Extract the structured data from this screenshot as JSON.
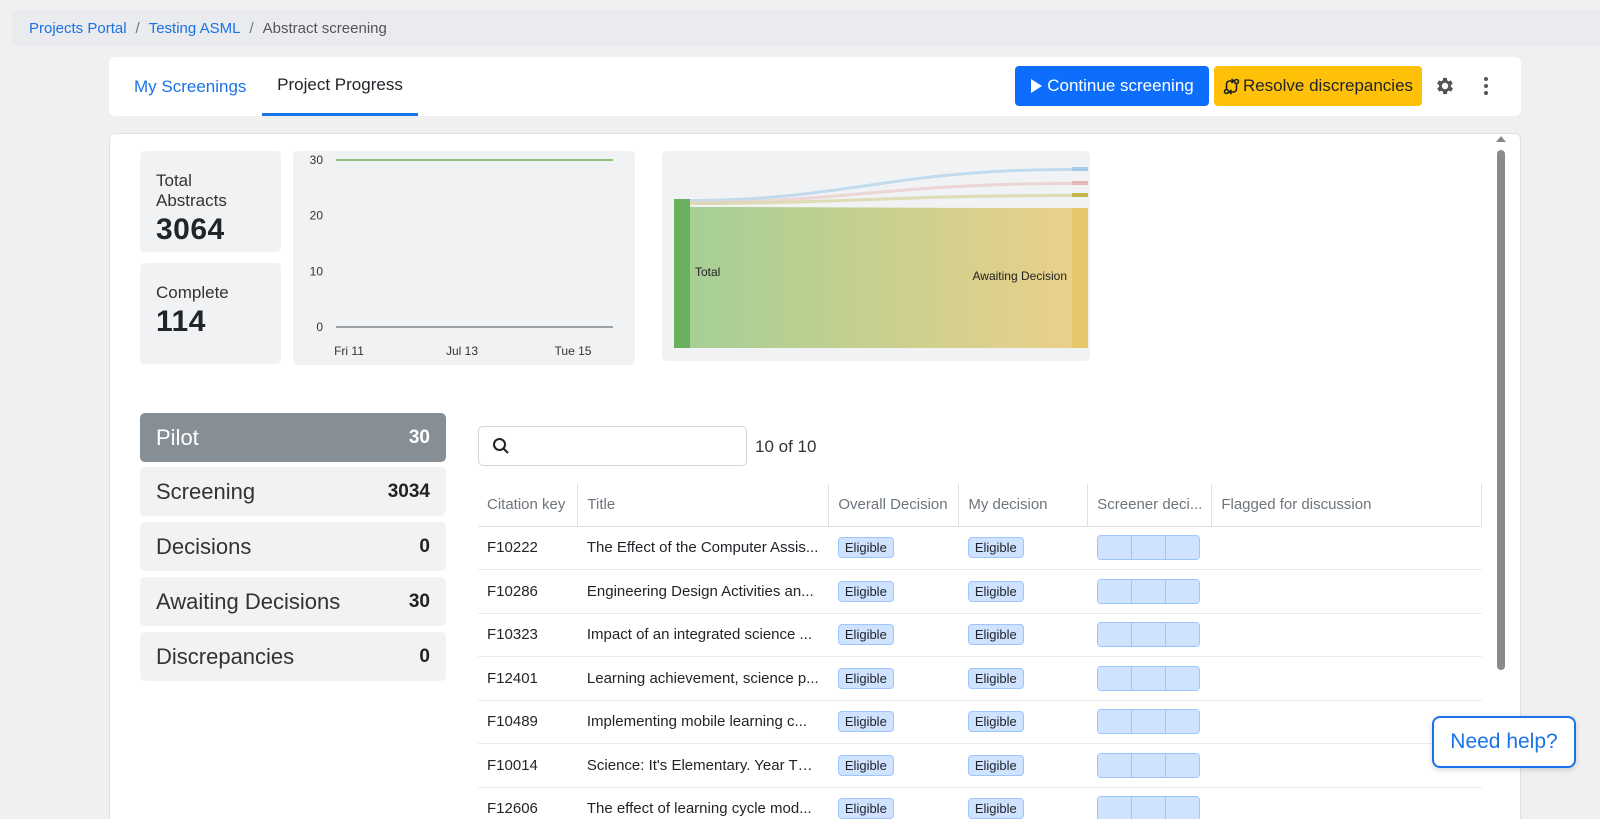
{
  "breadcrumb": {
    "items": [
      "Projects Portal",
      "Testing ASML"
    ],
    "current": "Abstract screening",
    "separator": "/"
  },
  "tabs": {
    "my_screenings": "My Screenings",
    "project_progress": "Project Progress",
    "active": "Project Progress"
  },
  "toolbar": {
    "continue_label": "Continue screening",
    "resolve_label": "Resolve discrepancies",
    "settings_icon": "gear-icon",
    "more_icon": "kebab-icon"
  },
  "stats": {
    "total_label": "Total Abstracts",
    "total_value": "3064",
    "complete_label": "Complete",
    "complete_value": "114"
  },
  "chart_data": [
    {
      "type": "line",
      "title": "",
      "x": [
        "Fri 11",
        "Jul 13",
        "Tue 15"
      ],
      "y_ticks": [
        0,
        10,
        20,
        30
      ],
      "ylim": [
        0,
        30
      ],
      "series": [
        {
          "color": "#8dc07a",
          "values": [
            30,
            30,
            30
          ]
        },
        {
          "color": "#9aa0a6",
          "values": [
            0,
            0,
            0
          ]
        }
      ]
    },
    {
      "type": "sankey",
      "nodes": [
        "Total",
        "Awaiting Decision"
      ],
      "links": [
        {
          "source": "Total",
          "target": "Awaiting Decision",
          "color": "#e6c86a"
        }
      ]
    }
  ],
  "sankey_labels": {
    "source": "Total",
    "target": "Awaiting Decision"
  },
  "stages": [
    {
      "label": "Pilot",
      "count": "30",
      "active": true
    },
    {
      "label": "Screening",
      "count": "3034",
      "active": false
    },
    {
      "label": "Decisions",
      "count": "0",
      "active": false
    },
    {
      "label": "Awaiting Decisions",
      "count": "30",
      "active": false
    },
    {
      "label": "Discrepancies",
      "count": "0",
      "active": false
    }
  ],
  "search": {
    "placeholder": "",
    "count_text": "10 of 10"
  },
  "table": {
    "headers": [
      "Citation key",
      "Title",
      "Overall Decision",
      "My decision",
      "Screener deci...",
      "Flagged for discussion"
    ],
    "rows": [
      {
        "key": "F10222",
        "title": "The Effect of the Computer Assis...",
        "overall": "Eligible",
        "mine": "Eligible"
      },
      {
        "key": "F10286",
        "title": "Engineering Design Activities an...",
        "overall": "Eligible",
        "mine": "Eligible"
      },
      {
        "key": "F10323",
        "title": "Impact of an integrated science ...",
        "overall": "Eligible",
        "mine": "Eligible"
      },
      {
        "key": "F12401",
        "title": "Learning achievement, science p...",
        "overall": "Eligible",
        "mine": "Eligible"
      },
      {
        "key": "F10489",
        "title": "Implementing mobile learning c...",
        "overall": "Eligible",
        "mine": "Eligible"
      },
      {
        "key": "F10014",
        "title": "Science: It's Elementary. Year Thr...",
        "overall": "Eligible",
        "mine": "Eligible"
      },
      {
        "key": "F12606",
        "title": "The effect of learning cycle mod...",
        "overall": "Eligible",
        "mine": "Eligible"
      }
    ]
  },
  "help": {
    "label": "Need help?"
  },
  "colors": {
    "primary": "#0d6efd",
    "warning": "#ffc107",
    "link": "#1a73e8",
    "active_stage": "#868e96"
  }
}
